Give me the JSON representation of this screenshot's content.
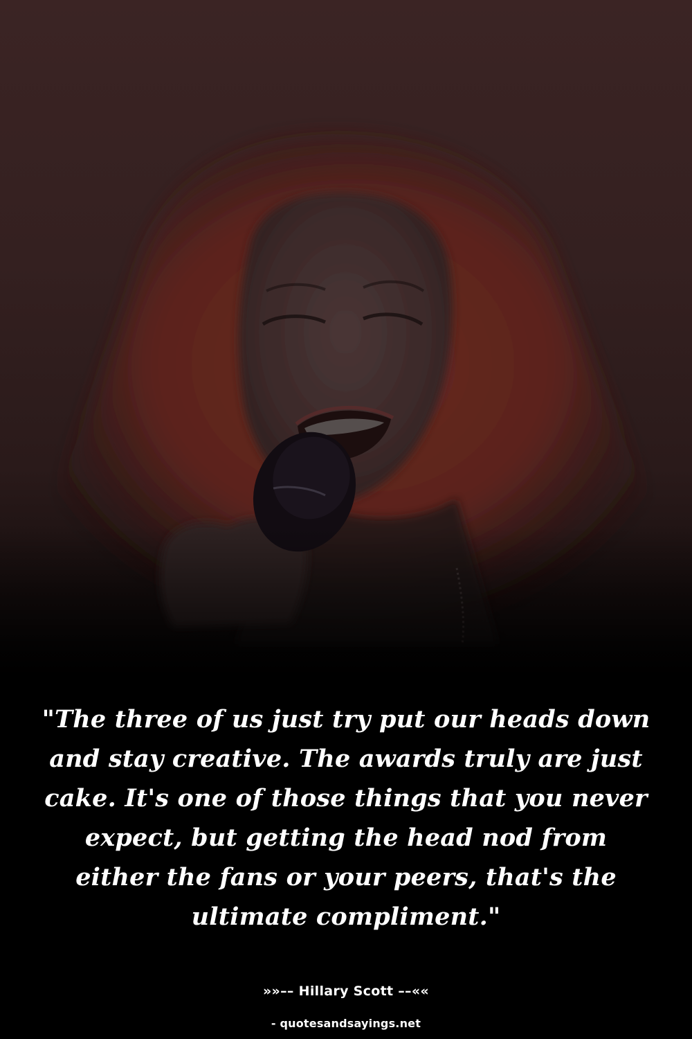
{
  "quote": {
    "text": "\"The three of us just try put our heads down and stay creative. The awards truly are just cake. It's one of those things that you never expect, but getting the head nod from either the fans or your peers, that's the ultimate compliment.\""
  },
  "author": {
    "label": "»»–– Hillary Scott ––««"
  },
  "source": {
    "label": "- quotesandsayings.net"
  },
  "colors": {
    "background": "#000000",
    "text": "#ffffff",
    "hair": "#7a2a22",
    "upper_backdrop": "#3a2222"
  }
}
